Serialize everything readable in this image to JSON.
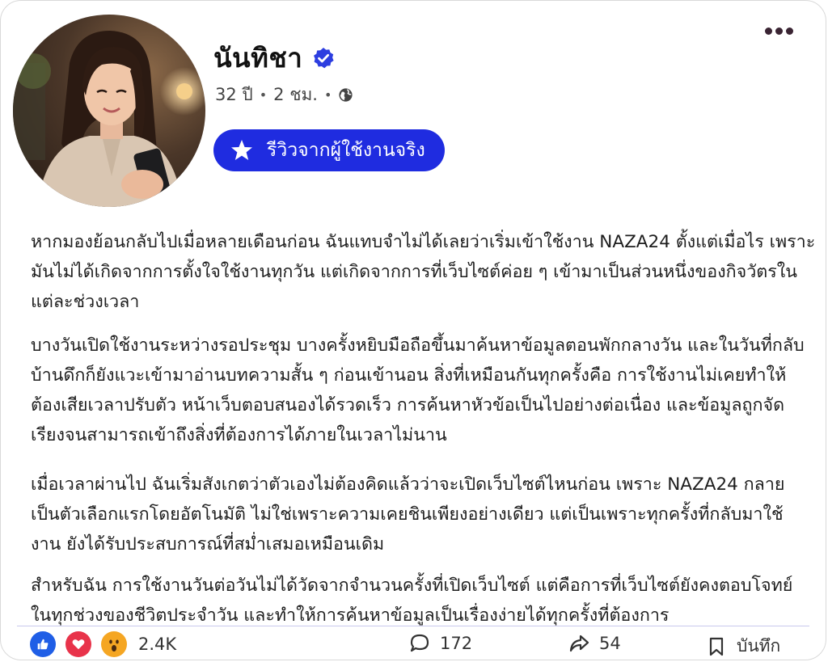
{
  "post": {
    "author": {
      "name": "นันทิชา",
      "age": "32 ปี",
      "time": "2 ชม."
    },
    "badge": {
      "label": "รีวิวจากผู้ใช้งานจริง",
      "icon": "star-icon"
    },
    "body": {
      "paragraph1": "หากมองย้อนกลับไปเมื่อหลายเดือนก่อน ฉันแทบจำไม่ได้เลยว่าเริ่มเข้าใช้งาน NAZA24 ตั้งแต่เมื่อไร เพราะมันไม่ได้เกิดจากการตั้งใจใช้งานทุกวัน แต่เกิดจากการที่เว็บไซต์ค่อย ๆ เข้ามาเป็นส่วนหนึ่งของกิจวัตรในแต่ละช่วงเวลา",
      "paragraph2": "บางวันเปิดใช้งานระหว่างรอประชุม บางครั้งหยิบมือถือขึ้นมาค้นหาข้อมูลตอนพักกลางวัน และในวันที่กลับบ้านดึกก็ยังแวะเข้ามาอ่านบทความสั้น ๆ ก่อนเข้านอน สิ่งที่เหมือนกันทุกครั้งคือ การใช้งานไม่เคยทำให้ต้องเสียเวลาปรับตัว หน้าเว็บตอบสนองได้รวดเร็ว การค้นหาหัวข้อเป็นไปอย่างต่อเนื่อง และข้อมูลถูกจัดเรียงจนสามารถเข้าถึงสิ่งที่ต้องการได้ภายในเวลาไม่นาน",
      "paragraph3": "เมื่อเวลาผ่านไป ฉันเริ่มสังเกตว่าตัวเองไม่ต้องคิดแล้วว่าจะเปิดเว็บไซต์ไหนก่อน เพราะ NAZA24 กลายเป็นตัวเลือกแรกโดยอัตโนมัติ ไม่ใช่เพราะความเคยชินเพียงอย่างเดียว แต่เป็นเพราะทุกครั้งที่กลับมาใช้งาน ยังได้รับประสบการณ์ที่สม่ำเสมอเหมือนเดิม",
      "paragraph4": "สำหรับฉัน การใช้งานวันต่อวันไม่ได้วัดจากจำนวนครั้งที่เปิดเว็บไซต์ แต่คือการที่เว็บไซต์ยังคงตอบโจทย์ในทุกช่วงของชีวิตประจำวัน และทำให้การค้นหาข้อมูลเป็นเรื่องง่ายได้ทุกครั้งที่ต้องการ"
    },
    "footer": {
      "reaction_count": "2.4K",
      "comment_count": "172",
      "share_count": "54",
      "save_label": "บันทึก"
    }
  },
  "colors": {
    "badge": "#1f2ce0",
    "like": "#1f5ee6",
    "love": "#e8334a",
    "wow": "#f5a623",
    "verified": "#2d3ee0"
  }
}
